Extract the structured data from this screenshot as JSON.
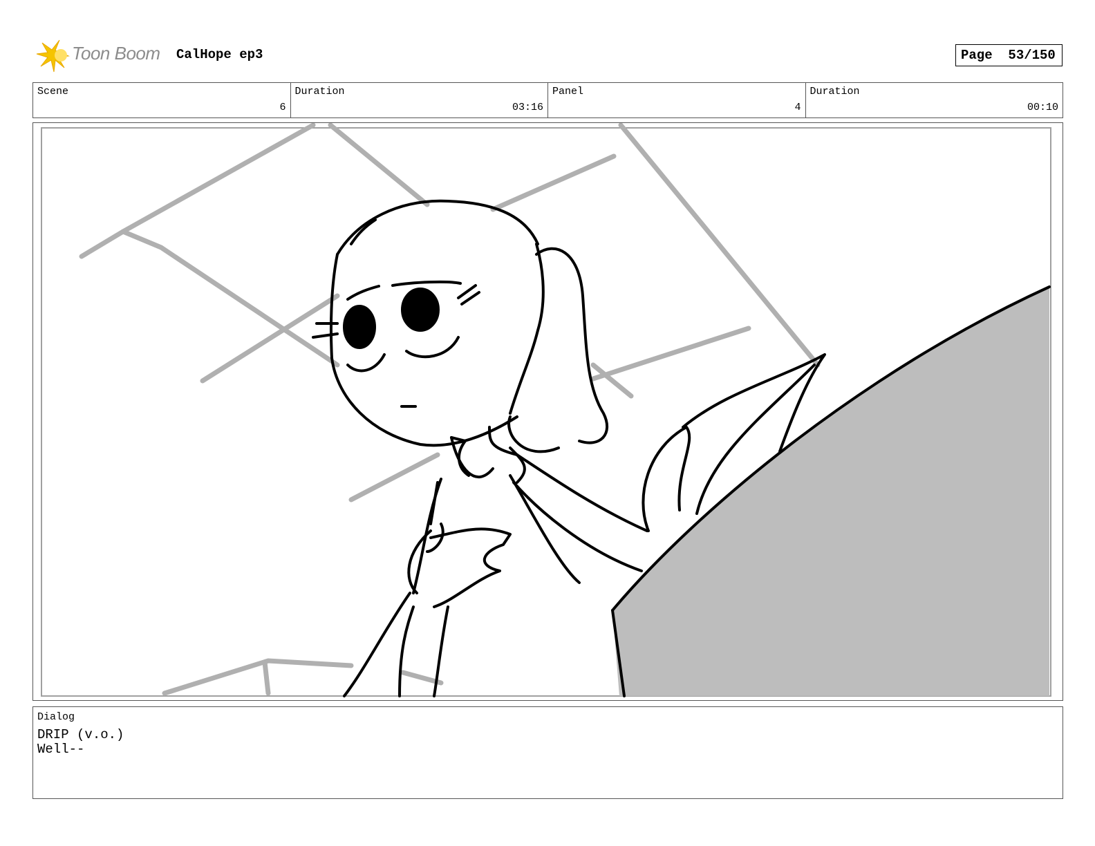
{
  "header": {
    "logo_text": "Toon Boom",
    "project_title": "CalHope ep3",
    "page_label": "Page",
    "page_number": "53/150"
  },
  "info": {
    "scene_label": "Scene",
    "scene_value": "6",
    "scene_duration_label": "Duration",
    "scene_duration_value": "03:16",
    "panel_label": "Panel",
    "panel_value": "4",
    "panel_duration_label": "Duration",
    "panel_duration_value": "00:10"
  },
  "dialog": {
    "label": "Dialog",
    "speaker": "DRIP (v.o.)",
    "line": "Well--"
  }
}
